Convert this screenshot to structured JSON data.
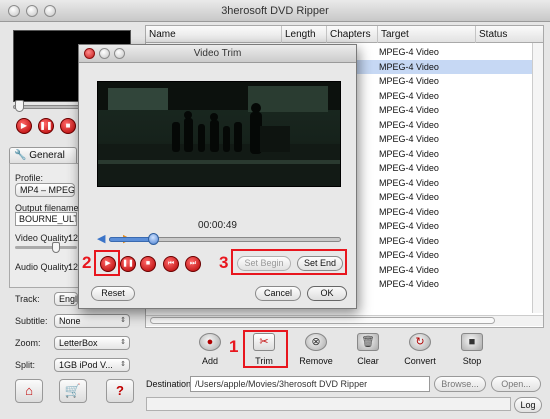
{
  "app": {
    "title": "3herosoft DVD Ripper"
  },
  "left_panel": {
    "tab_general": "General",
    "profile_label": "Profile:",
    "profile_value": "MP4 – MPEG-",
    "output_filename_label": "Output filename:",
    "output_filename_value": "BOURNE_ULTIM",
    "video_quality_label": "Video Quality:",
    "video_quality_value": "12",
    "audio_quality_label": "Audio Quality:",
    "audio_quality_value": "12",
    "track_label": "Track:",
    "track_value": "Engl",
    "subtitle_label": "Subtitle:",
    "subtitle_value": "None",
    "zoom_label": "Zoom:",
    "zoom_value": "LetterBox",
    "split_label": "Split:",
    "split_value": "1GB iPod V..."
  },
  "table": {
    "columns": [
      "Name",
      "Length",
      "Chapters",
      "Target",
      "Status"
    ],
    "rows": [
      {
        "target": "MPEG-4 Video",
        "selected": false
      },
      {
        "target": "MPEG-4 Video",
        "selected": true
      },
      {
        "target": "MPEG-4 Video",
        "selected": false
      },
      {
        "target": "MPEG-4 Video",
        "selected": false
      },
      {
        "target": "MPEG-4 Video",
        "selected": false
      },
      {
        "target": "MPEG-4 Video",
        "selected": false
      },
      {
        "target": "MPEG-4 Video",
        "selected": false
      },
      {
        "target": "MPEG-4 Video",
        "selected": false
      },
      {
        "target": "MPEG-4 Video",
        "selected": false
      },
      {
        "target": "MPEG-4 Video",
        "selected": false
      },
      {
        "target": "MPEG-4 Video",
        "selected": false
      },
      {
        "target": "MPEG-4 Video",
        "selected": false
      },
      {
        "target": "MPEG-4 Video",
        "selected": false
      },
      {
        "target": "MPEG-4 Video",
        "selected": false
      },
      {
        "target": "MPEG-4 Video",
        "selected": false
      },
      {
        "target": "MPEG-4 Video",
        "selected": false
      },
      {
        "target": "MPEG-4 Video",
        "selected": false
      }
    ]
  },
  "toolbar": {
    "add": "Add",
    "trim": "Trim",
    "remove": "Remove",
    "clear": "Clear",
    "convert": "Convert",
    "stop": "Stop"
  },
  "destination": {
    "label": "Destination:",
    "path": "/Users/apple/Movies/3herosoft DVD Ripper",
    "browse": "Browse...",
    "open": "Open...",
    "log": "Log"
  },
  "dialog": {
    "title": "Video Trim",
    "timecode": "00:00:49",
    "position_fraction": 0.19,
    "set_begin": "Set Begin",
    "set_end": "Set End",
    "reset": "Reset",
    "cancel": "Cancel",
    "ok": "OK"
  },
  "annotations": {
    "step1": "1",
    "step2": "2",
    "step3": "3",
    "color": "#e8161e"
  }
}
